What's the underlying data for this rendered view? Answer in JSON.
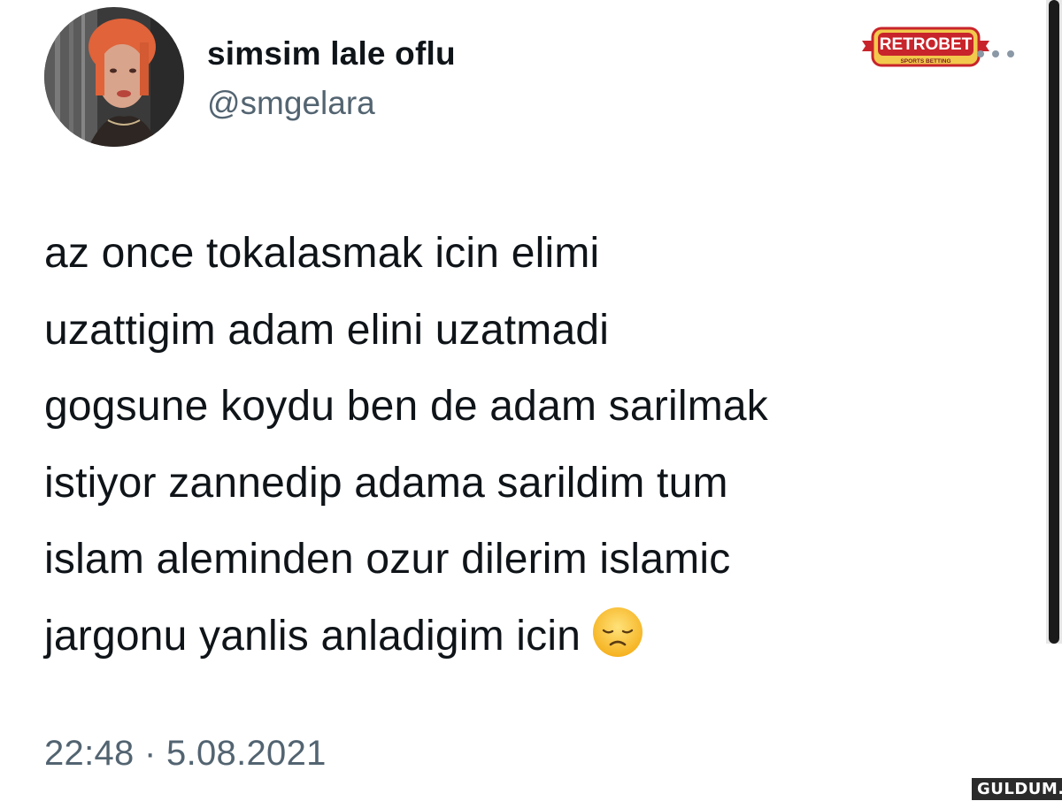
{
  "tweet": {
    "author": {
      "display_name": "simsim lale oflu",
      "handle": "@smgelara",
      "avatar_icon": "profile-photo"
    },
    "text_lines": [
      "az once tokalasmak icin elimi",
      "uzattigim adam elini uzatmadi",
      "gogsune koydu ben de adam sarilmak",
      "istiyor zannedip adama sarildim tum",
      "islam aleminden ozur dilerim islamic",
      "jargonu yanlis anladigim icin"
    ],
    "emoji": "disappointed-face-emoji",
    "timestamp": "22:48 · 5.08.2021",
    "more_icon": "more-horizontal-icon"
  },
  "overlay_logo": {
    "brand": "RETROBET",
    "tagline": "SPORTS BETTING",
    "color": "#c8242b"
  },
  "watermark": {
    "text": "GULDUM.NET"
  },
  "colors": {
    "text_primary": "#0f1419",
    "text_secondary": "#536471",
    "background": "#ffffff"
  }
}
